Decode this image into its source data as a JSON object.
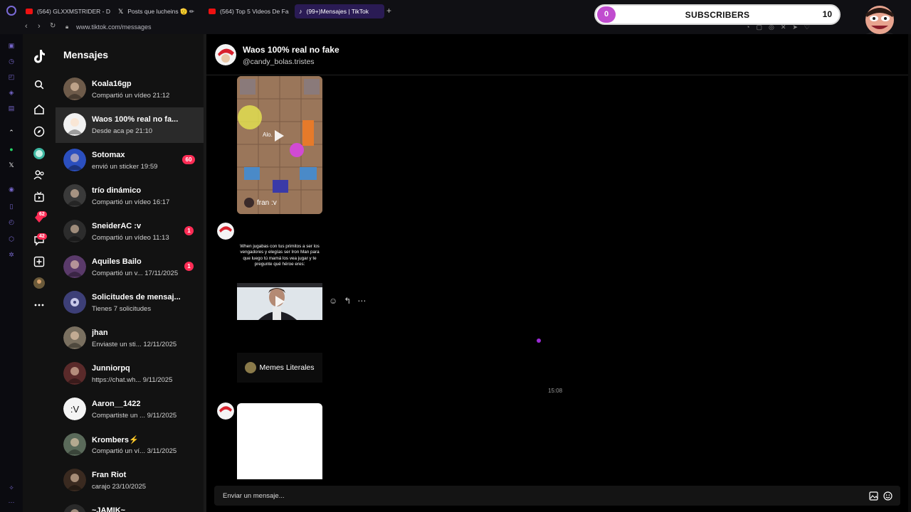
{
  "browser": {
    "tabs": [
      {
        "title": "(564) GLXXMSTRIDER - D",
        "icon": "youtube-icon",
        "active": false
      },
      {
        "title": "Posts que lucheins 🫡 ✏",
        "icon": "x-icon",
        "active": false
      },
      {
        "title": "(564) Top 5 Videos De Fa",
        "icon": "youtube-icon",
        "active": false
      },
      {
        "title": "(99+)Mensajes | TikTok",
        "icon": "tiktok-icon",
        "active": true
      }
    ],
    "url": "www.tiktok.com/messages"
  },
  "subscriber_widget": {
    "label": "SUBSCRIBERS",
    "current": "0",
    "goal": "10",
    "progress": 0
  },
  "nav": {
    "badges": {
      "activity": "62",
      "inbox": "42"
    }
  },
  "conversations": {
    "title": "Mensajes",
    "items": [
      {
        "name": "Koala16gp",
        "preview": "Compartió un vídeo 21:12",
        "badge": ""
      },
      {
        "name": "Waos 100% real no fa...",
        "preview": "Desde aca pe 21:10",
        "badge": ""
      },
      {
        "name": "Sotomax",
        "preview": "envió un sticker 19:59",
        "badge": "60"
      },
      {
        "name": "trío dinámico",
        "preview": "Compartió un vídeo 16:17",
        "badge": ""
      },
      {
        "name": "SneiderAC :v",
        "preview": "Compartió un vídeo 11:13",
        "badge": "1"
      },
      {
        "name": "Aquiles Bailo",
        "preview": "Compartió un v... 17/11/2025",
        "badge": "1"
      },
      {
        "name": "Solicitudes de mensaj...",
        "preview": "Tienes 7 solicitudes",
        "badge": ""
      },
      {
        "name": "jhan",
        "preview": "Enviaste un sti... 12/11/2025",
        "badge": ""
      },
      {
        "name": "Junniorpq",
        "preview": "https://chat.wh... 9/11/2025",
        "badge": ""
      },
      {
        "name": "Aaron__1422",
        "preview": "Compartiste un ... 9/11/2025",
        "badge": ""
      },
      {
        "name": "Krombers⚡",
        "preview": "Compartió un ví... 3/11/2025",
        "badge": ""
      },
      {
        "name": "Fran Riot",
        "preview": "carajo 23/10/2025",
        "badge": ""
      },
      {
        "name": "~JAMIK~",
        "preview": "",
        "badge": ""
      }
    ]
  },
  "chat": {
    "title": "Waos 100% real no fake",
    "handle": "@candy_bolas.tristes",
    "video_card": {
      "caption": "fran :v",
      "overlay_text": "Alo."
    },
    "meme_text": "When jugabas con tus primitos a ser los vengadores y elegías ser Iron Man para que luego tú mamá los vea jugar y te pregunte qué héroe eres:",
    "source_label": "Memes Literales",
    "timestamp": "15:08",
    "input_placeholder": "Enviar un mensaje..."
  }
}
